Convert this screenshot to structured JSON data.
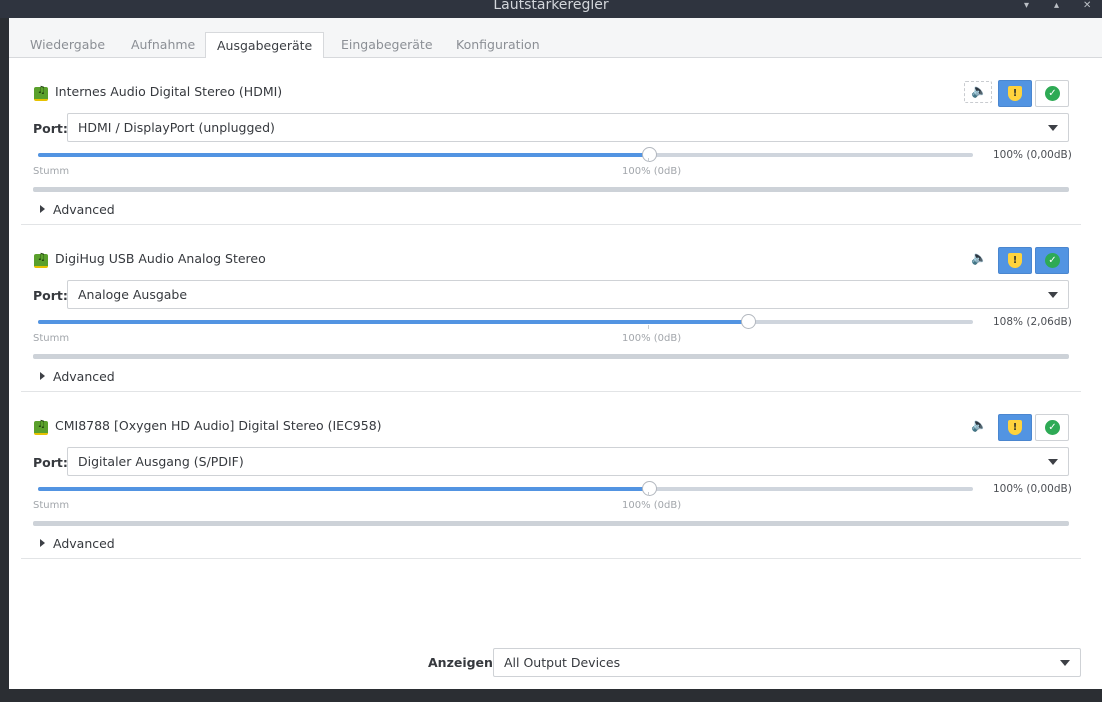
{
  "window": {
    "title": "Lautstärkeregler",
    "controls": [
      "▾",
      "▴",
      "✕"
    ]
  },
  "tabs": [
    {
      "label": "Wiedergabe",
      "active": false
    },
    {
      "label": "Aufnahme",
      "active": false
    },
    {
      "label": "Ausgabegeräte",
      "active": true
    },
    {
      "label": "Eingabegeräte",
      "active": false
    },
    {
      "label": "Konfiguration",
      "active": false
    }
  ],
  "devices": [
    {
      "name": "Internes Audio Digital Stereo (HDMI)",
      "port_label": "Port:",
      "port_value": "HDMI / DisplayPort (unplugged)",
      "volume_percent": 100,
      "volume_text": "100% (0,00dB)",
      "tick_left": "Stumm",
      "tick_mid": "100% (0dB)",
      "advanced_label": "Advanced",
      "default_active": false
    },
    {
      "name": "DigiHug USB Audio Analog Stereo",
      "port_label": "Port:",
      "port_value": "Analoge Ausgabe",
      "volume_percent": 108,
      "volume_text": "108% (2,06dB)",
      "tick_left": "Stumm",
      "tick_mid": "100% (0dB)",
      "advanced_label": "Advanced",
      "default_active": true
    },
    {
      "name": "CMI8788 [Oxygen HD Audio] Digital Stereo (IEC958)",
      "port_label": "Port:",
      "port_value": "Digitaler Ausgang (S/PDIF)",
      "volume_percent": 100,
      "volume_text": "100% (0,00dB)",
      "tick_left": "Stumm",
      "tick_mid": "100% (0dB)",
      "advanced_label": "Advanced",
      "default_active": false
    }
  ],
  "footer": {
    "show_label": "Anzeigen:",
    "show_value": "All Output Devices"
  },
  "icons": {
    "device": "audio-card-icon",
    "mute": "speaker-icon",
    "lock": "lock-icon",
    "default": "check-icon"
  },
  "colors": {
    "accent": "#5294e2",
    "check": "#2eaa55",
    "lock": "#ffd33d"
  }
}
